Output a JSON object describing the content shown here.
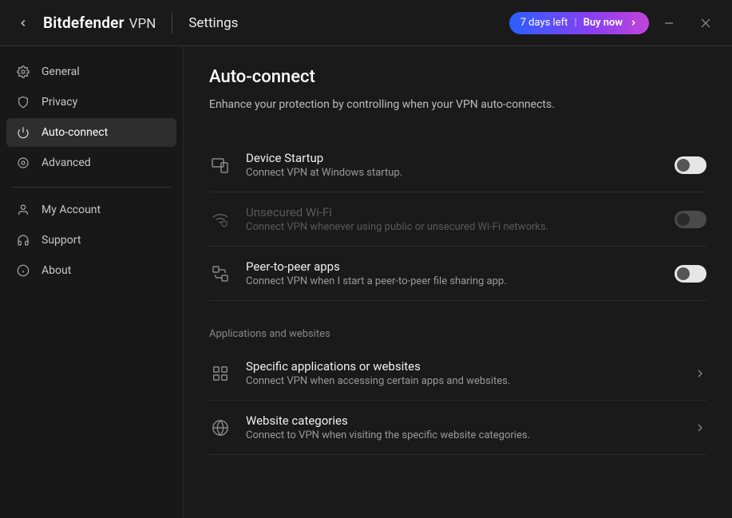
{
  "brand": {
    "main": "Bitdefender",
    "sub": "VPN"
  },
  "header": {
    "page_title": "Settings",
    "trial_text": "7 days left",
    "buy_label": "Buy now"
  },
  "sidebar": {
    "items": [
      {
        "label": "General"
      },
      {
        "label": "Privacy"
      },
      {
        "label": "Auto-connect"
      },
      {
        "label": "Advanced"
      }
    ],
    "secondary": [
      {
        "label": "My Account"
      },
      {
        "label": "Support"
      },
      {
        "label": "About"
      }
    ]
  },
  "page": {
    "title": "Auto-connect",
    "subtitle": "Enhance your protection by controlling when your VPN auto-connects.",
    "section_label": "Applications and websites",
    "rows": {
      "startup": {
        "title": "Device Startup",
        "desc": "Connect VPN at Windows startup."
      },
      "wifi": {
        "title": "Unsecured Wi-Fi",
        "desc": "Connect VPN whenever using public or unsecured Wi-Fi networks."
      },
      "p2p": {
        "title": "Peer-to-peer apps",
        "desc": "Connect VPN when I start a peer-to-peer file sharing app."
      },
      "apps": {
        "title": "Specific applications or websites",
        "desc": "Connect VPN when accessing certain apps and websites."
      },
      "categories": {
        "title": "Website categories",
        "desc": "Connect to VPN when visiting the specific website categories."
      }
    }
  }
}
